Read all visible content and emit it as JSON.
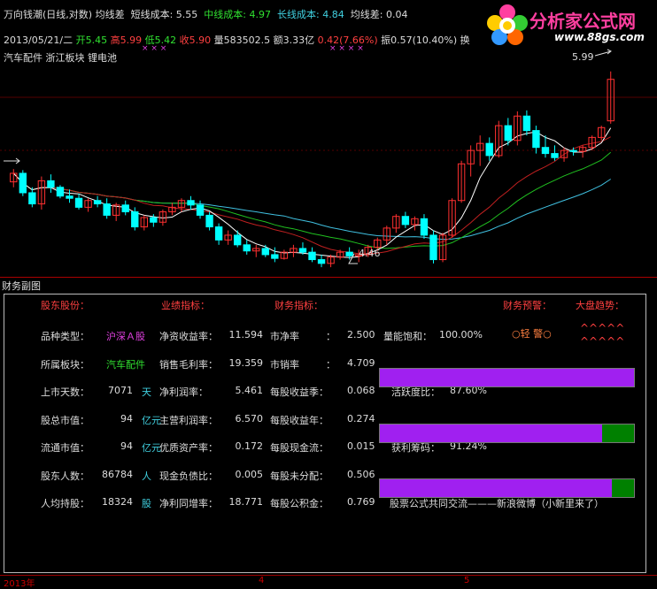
{
  "header": {
    "title": "万向钱潮(日线,对数) 均线差",
    "short_label": "短线成本:",
    "short_val": "5.55",
    "mid_label": "中线成本:",
    "mid_val": "4.97",
    "long_label": "长线成本:",
    "long_val": "4.84",
    "ma_label": "均线差:",
    "ma_val": "0.04",
    "date": "2013/05/21/二",
    "open_l": "开",
    "open": "5.45",
    "high_l": "高",
    "high": "5.99",
    "low_l": "低",
    "low": "5.42",
    "close_l": "收",
    "close": "5.90",
    "vol_l": "量",
    "vol": "583502.5",
    "amt_l": "额",
    "amt": "3.33亿",
    "chg": "0.42(7.66%)",
    "amp_l": "振",
    "amp": "0.57(10.40%)",
    "swap_l": "换",
    "sectors": "汽车配件 浙江板块 锂电池",
    "marks": "×  ×  ×",
    "marks2": "× ×  ×  ×"
  },
  "logo": {
    "text": "分析家公式网",
    "url": "www.88gs.com"
  },
  "chart_data": {
    "type": "candlestick",
    "title": "万向钱潮(日线,对数)",
    "high_label": "5.99",
    "low_label": "4.46",
    "ylim": [
      4.3,
      6.1
    ],
    "x_ticks": [
      "2013年",
      "4",
      "5"
    ],
    "candles": [
      [
        4.85,
        4.97,
        4.8,
        4.93
      ],
      [
        4.93,
        4.96,
        4.72,
        4.75
      ],
      [
        4.75,
        4.8,
        4.62,
        4.65
      ],
      [
        4.65,
        4.9,
        4.6,
        4.86
      ],
      [
        4.86,
        4.92,
        4.75,
        4.8
      ],
      [
        4.8,
        4.82,
        4.7,
        4.72
      ],
      [
        4.72,
        4.78,
        4.66,
        4.7
      ],
      [
        4.7,
        4.74,
        4.6,
        4.62
      ],
      [
        4.62,
        4.7,
        4.58,
        4.68
      ],
      [
        4.68,
        4.72,
        4.62,
        4.65
      ],
      [
        4.65,
        4.7,
        4.52,
        4.55
      ],
      [
        4.55,
        4.66,
        4.5,
        4.64
      ],
      [
        4.64,
        4.68,
        4.55,
        4.58
      ],
      [
        4.58,
        4.62,
        4.42,
        4.45
      ],
      [
        4.45,
        4.55,
        4.42,
        4.53
      ],
      [
        4.53,
        4.56,
        4.45,
        4.49
      ],
      [
        4.49,
        4.6,
        4.46,
        4.58
      ],
      [
        4.58,
        4.66,
        4.55,
        4.62
      ],
      [
        4.62,
        4.7,
        4.58,
        4.68
      ],
      [
        4.68,
        4.72,
        4.6,
        4.64
      ],
      [
        4.64,
        4.68,
        4.52,
        4.55
      ],
      [
        4.55,
        4.58,
        4.42,
        4.45
      ],
      [
        4.45,
        4.48,
        4.3,
        4.34
      ],
      [
        4.34,
        4.42,
        4.3,
        4.38
      ],
      [
        4.38,
        4.42,
        4.28,
        4.3
      ],
      [
        4.3,
        4.34,
        4.22,
        4.25
      ],
      [
        4.25,
        4.3,
        4.2,
        4.27
      ],
      [
        4.27,
        4.3,
        4.2,
        4.22
      ],
      [
        4.22,
        4.28,
        4.16,
        4.19
      ],
      [
        4.19,
        4.26,
        4.18,
        4.24
      ],
      [
        4.24,
        4.3,
        4.2,
        4.27
      ],
      [
        4.27,
        4.32,
        4.22,
        4.24
      ],
      [
        4.24,
        4.28,
        4.16,
        4.18
      ],
      [
        4.18,
        4.22,
        4.12,
        4.15
      ],
      [
        4.15,
        4.22,
        4.12,
        4.2
      ],
      [
        4.2,
        4.26,
        4.18,
        4.24
      ],
      [
        4.24,
        4.28,
        4.18,
        4.21
      ],
      [
        4.21,
        4.26,
        4.16,
        4.22
      ],
      [
        4.22,
        4.3,
        4.2,
        4.28
      ],
      [
        4.28,
        4.36,
        4.25,
        4.34
      ],
      [
        4.34,
        4.46,
        4.3,
        4.44
      ],
      [
        4.44,
        4.56,
        4.4,
        4.54
      ],
      [
        4.54,
        4.58,
        4.44,
        4.47
      ],
      [
        4.47,
        4.54,
        4.42,
        4.52
      ],
      [
        4.52,
        4.56,
        4.35,
        4.38
      ],
      [
        4.38,
        4.42,
        4.15,
        4.18
      ],
      [
        4.18,
        4.4,
        4.16,
        4.38
      ],
      [
        4.38,
        4.7,
        4.36,
        4.68
      ],
      [
        4.68,
        5.05,
        4.66,
        5.02
      ],
      [
        5.02,
        5.2,
        4.9,
        5.15
      ],
      [
        5.15,
        5.3,
        5.0,
        5.22
      ],
      [
        5.22,
        5.28,
        5.05,
        5.1
      ],
      [
        5.1,
        5.45,
        5.08,
        5.4
      ],
      [
        5.4,
        5.48,
        5.2,
        5.25
      ],
      [
        5.25,
        5.55,
        5.2,
        5.5
      ],
      [
        5.5,
        5.56,
        5.3,
        5.35
      ],
      [
        5.35,
        5.4,
        5.12,
        5.18
      ],
      [
        5.18,
        5.3,
        5.08,
        5.12
      ],
      [
        5.12,
        5.2,
        5.05,
        5.08
      ],
      [
        5.08,
        5.18,
        5.04,
        5.15
      ],
      [
        5.15,
        5.18,
        5.1,
        5.14
      ],
      [
        5.14,
        5.2,
        5.08,
        5.18
      ],
      [
        5.18,
        5.3,
        5.15,
        5.28
      ],
      [
        5.28,
        5.4,
        5.25,
        5.38
      ],
      [
        5.45,
        5.99,
        5.42,
        5.9
      ]
    ]
  },
  "fin": {
    "hdr_holders": "股东股份：",
    "hdr_perf": "业绩指标：",
    "hdr_fin": "财务指标：",
    "hdr_warn": "财务预警：",
    "hdr_trend": "大盘趋势：",
    "warn_val": "○轻 警○",
    "trend_val": "^^^^^ ^^^^^",
    "panel_title": "财务副图",
    "rows": [
      {
        "l1": "品种类型：",
        "v1": "沪深Ａ股",
        "l2": "净资收益率：",
        "v2": "11.594",
        "l3": "市净率",
        "c3": "：",
        "v3": "2.500",
        "l4": "量能饱和：",
        "v4": "100.00%"
      },
      {
        "l1": "所属板块：",
        "v1": "汽车配件",
        "l2": "销售毛利率：",
        "v2": "19.359",
        "l3": "市销率",
        "c3": "：",
        "v3": "4.709",
        "l4": "",
        "v4": ""
      },
      {
        "l1": "上市天数：",
        "v1": "7071",
        "u1": "天",
        "l2": "净利润率：",
        "v2": "5.461",
        "l3": "每股收益季：",
        "c3": "",
        "v3": "0.068",
        "l4": "活跃度比：",
        "v4": "87.60%"
      },
      {
        "l1": "股总市值：",
        "v1": "94",
        "u1": "亿元",
        "l2": "主营利润率：",
        "v2": "6.570",
        "l3": "每股收益年：",
        "c3": "",
        "v3": "0.274",
        "l4": "",
        "v4": ""
      },
      {
        "l1": "流通市值：",
        "v1": "94",
        "u1": "亿元",
        "l2": "优质资产率：",
        "v2": "0.172",
        "l3": "每股现金流：",
        "c3": "",
        "v3": "0.015",
        "l4": "获利筹码：",
        "v4": "91.24%"
      },
      {
        "l1": "股东人数：",
        "v1": "86784",
        "u1": "人",
        "l2": "现金负债比：",
        "v2": "0.005",
        "l3": "每股未分配：",
        "c3": "",
        "v3": "0.506",
        "l4": "",
        "v4": ""
      },
      {
        "l1": "人均持股：",
        "v1": "18324",
        "u1": "股",
        "l2": "净利同增率：",
        "v2": "18.771",
        "l3": "每股公积金：",
        "c3": "",
        "v3": "0.769",
        "l4": "股票公式共同交流———新浪微博（小新里来了）",
        "v4": ""
      }
    ],
    "bars": [
      {
        "purple_fraction": 1.0
      },
      {
        "purple_fraction": 0.876
      },
      {
        "purple_fraction": 0.9124
      }
    ]
  },
  "axis": {
    "y_label": "4.46",
    "year": "2013年",
    "m4": "4",
    "m5": "5"
  },
  "colors": {
    "up": "#ff3030",
    "down": "#00ffff",
    "bg": "#000000",
    "bar": "#a020f0",
    "bar_green": "#008000"
  }
}
